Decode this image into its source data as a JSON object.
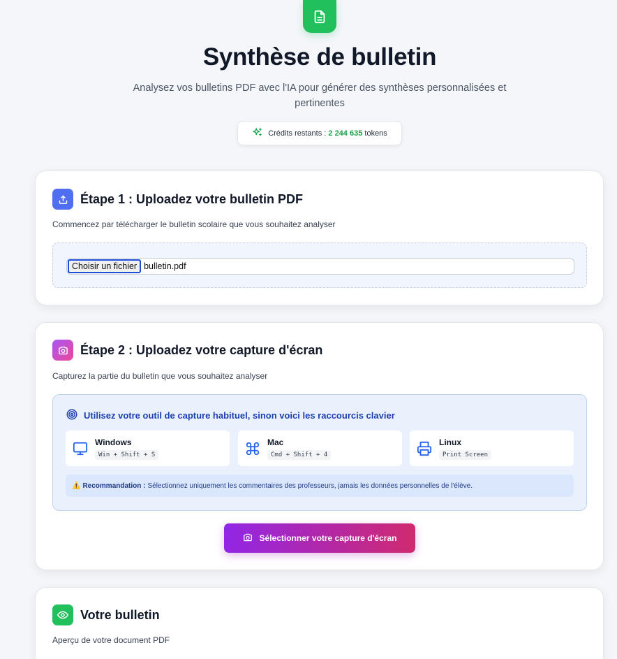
{
  "header": {
    "title": "Synthèse de bulletin",
    "subtitle": "Analysez vos bulletins PDF avec l'IA pour générer des synthèses personnalisées et pertinentes",
    "credits_label": "Crédits restants :",
    "credits_amount": "2 244 635",
    "credits_unit": "tokens",
    "icon": "document-icon"
  },
  "step1": {
    "title": "Étape 1 : Uploadez votre bulletin PDF",
    "description": "Commencez par télécharger le bulletin scolaire que vous souhaitez analyser",
    "file_button": "Choisir un fichier",
    "file_name": "bulletin.pdf",
    "icon": "upload-icon"
  },
  "step2": {
    "title": "Étape 2 : Uploadez votre capture d'écran",
    "description": "Capturez la partie du bulletin que vous souhaitez analyser",
    "tip_title": "Utilisez votre outil de capture habituel, sinon voici les raccourcis clavier",
    "shortcuts": [
      {
        "os": "Windows",
        "keys": "Win + Shift + S",
        "icon": "monitor-icon"
      },
      {
        "os": "Mac",
        "keys": "Cmd + Shift + 4",
        "icon": "command-icon"
      },
      {
        "os": "Linux",
        "keys": "Print Screen",
        "icon": "printer-icon"
      }
    ],
    "reco_emoji": "⚠️",
    "reco_label": "Recommandation :",
    "reco_text": "Sélectionnez uniquement les commentaires des professeurs, jamais les données personnelles de l'élève.",
    "capture_button": "Sélectionner votre capture d'écran",
    "icon": "camera-icon"
  },
  "preview": {
    "title": "Votre bulletin",
    "description": "Aperçu de votre document PDF",
    "icon": "eye-icon"
  },
  "colors": {
    "green": "#22c05d",
    "blue": "#4f6ef0",
    "pink_start": "#a855f7",
    "pink_end": "#ec4899",
    "tip_text": "#1e40af"
  }
}
